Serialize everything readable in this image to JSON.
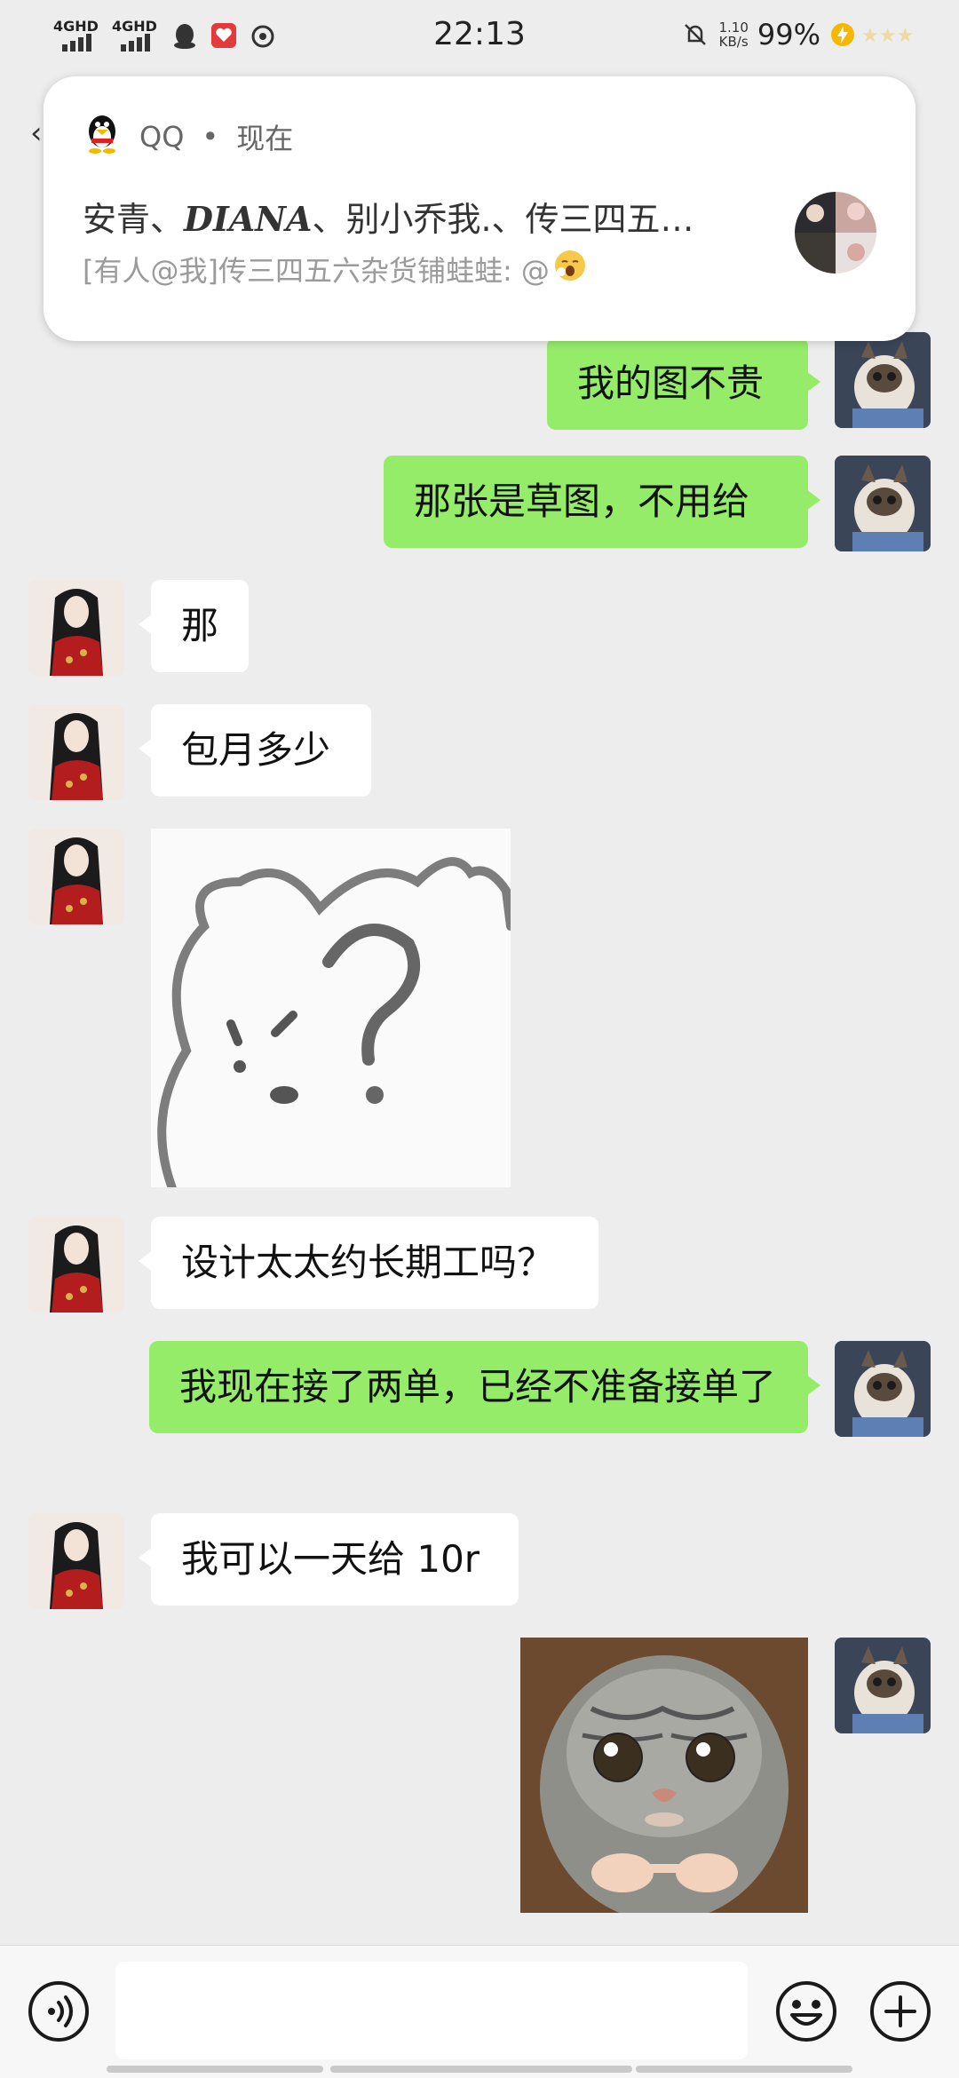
{
  "status_bar": {
    "net1": "4GHD",
    "net2": "4GHD",
    "time": "22:13",
    "speed_value": "1.10",
    "speed_unit": "KB/s",
    "battery": "99%"
  },
  "notification": {
    "app": "QQ",
    "dot": "•",
    "when": "现在",
    "title_prefix": "安青、",
    "title_em": "DIANA",
    "title_suffix": "、别小乔我.、传三四五…",
    "body": "[有人@我]传三四五六杂货铺蛙蛙: @"
  },
  "messages": [
    {
      "side": "me",
      "text": "我的图不贵"
    },
    {
      "side": "me",
      "text": "那张是草图，不用给"
    },
    {
      "side": "them",
      "text": "那"
    },
    {
      "side": "them",
      "text": "包月多少"
    },
    {
      "side": "them",
      "sticker": "question-dog-sticker"
    },
    {
      "side": "them",
      "text": "设计太太约长期工吗？"
    },
    {
      "side": "me",
      "text": "我现在接了两单，已经不准备接单了"
    },
    {
      "side": "them",
      "text": "我可以一天给 10r"
    },
    {
      "side": "me",
      "sticker": "pleading-cat-sticker"
    }
  ],
  "input": {
    "placeholder": ""
  },
  "colors": {
    "my_bubble": "#95ec69",
    "their_bubble": "#ffffff",
    "background": "#ededed"
  }
}
